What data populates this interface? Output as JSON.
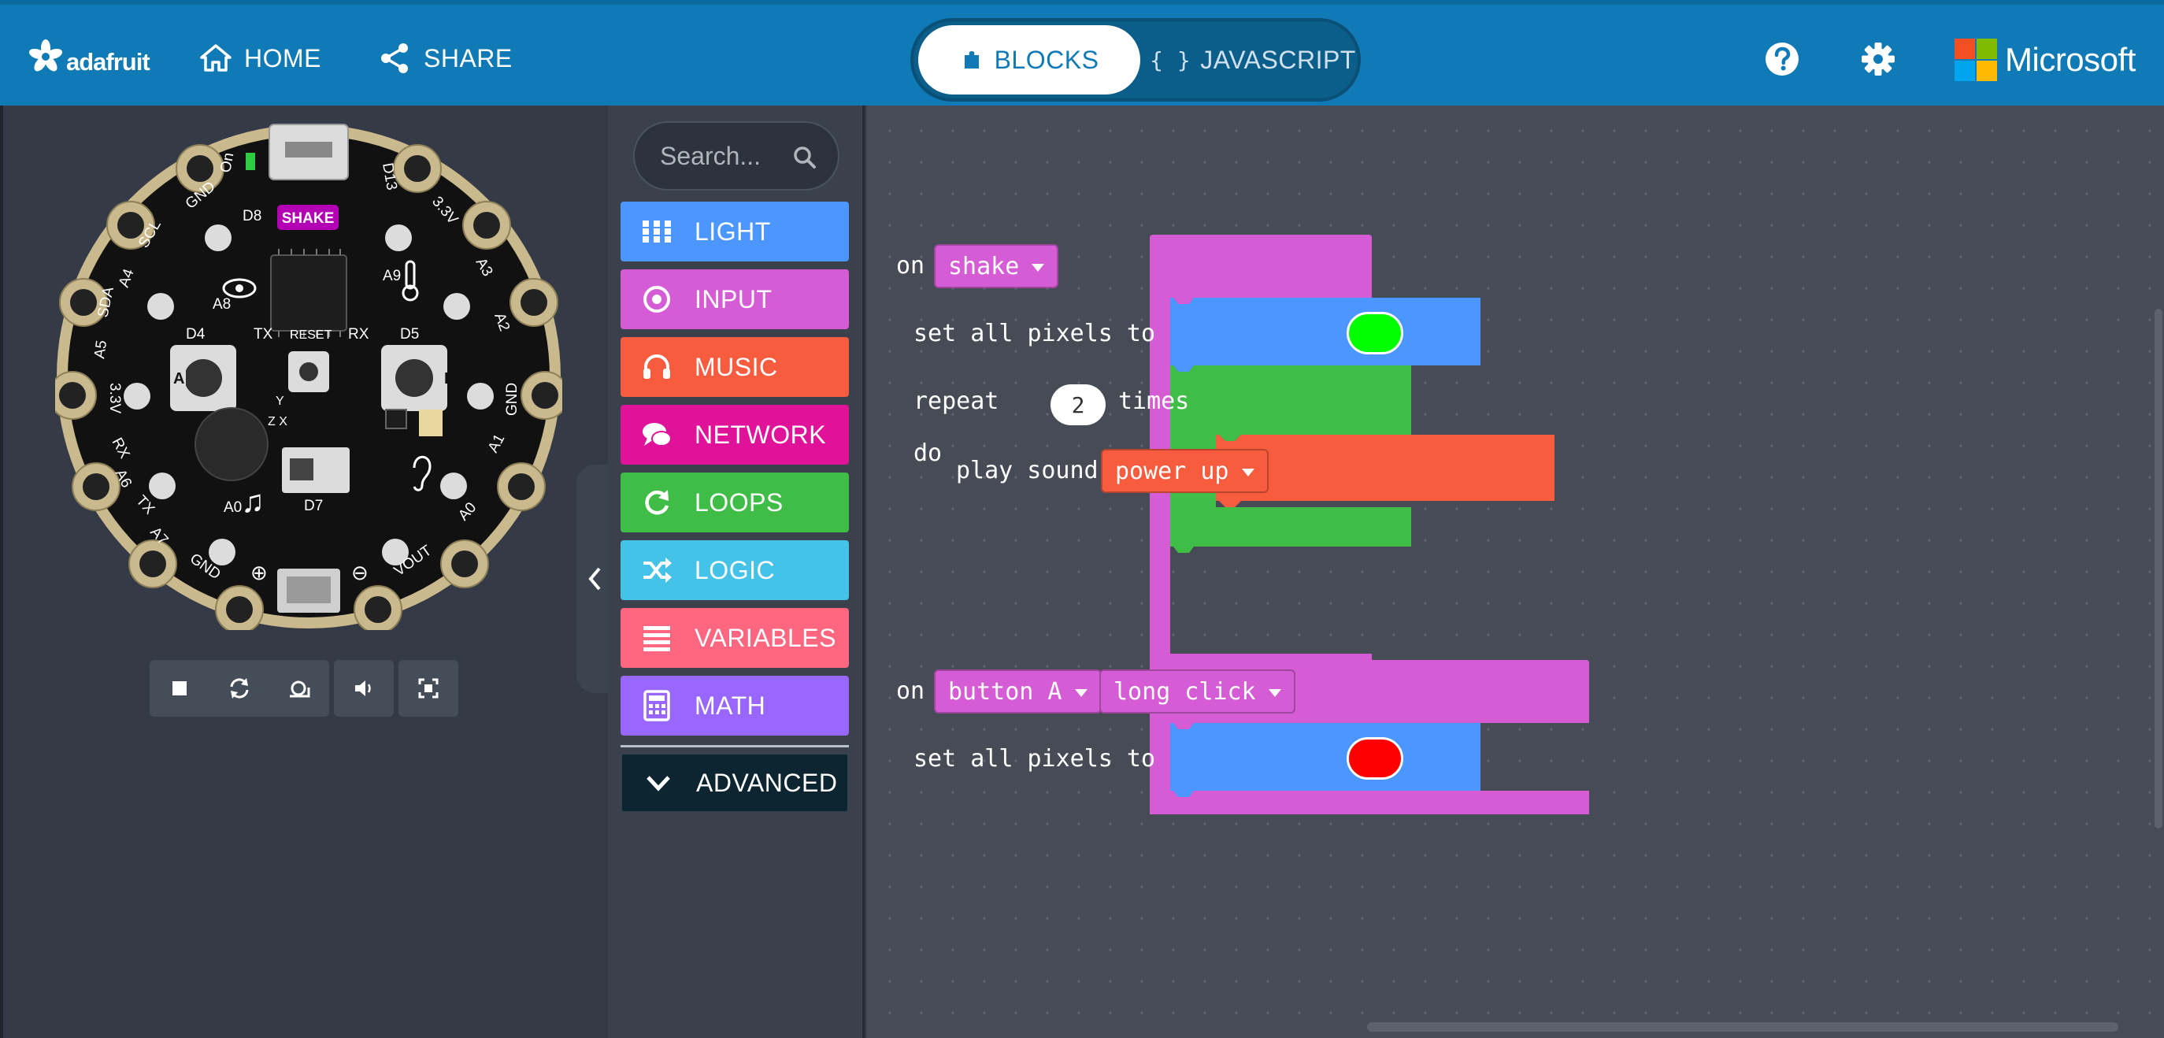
{
  "header": {
    "brand": "adafruit",
    "nav": {
      "home": "HOME",
      "share": "SHARE"
    },
    "mode_toggle": {
      "blocks": "BLOCKS",
      "javascript": "JAVASCRIPT",
      "active": "blocks"
    },
    "microsoft": "Microsoft"
  },
  "simulator": {
    "board_labels": {
      "shake": "SHAKE",
      "on": "On",
      "d13": "D13",
      "d8": "D8",
      "gnd_tl": "GND",
      "v33_tr": "3.3V",
      "scl": "SCL",
      "a3": "A3",
      "a4": "A4",
      "a2": "A2",
      "a8": "A8",
      "a9": "A9",
      "sda": "SDA",
      "a5": "A5",
      "d4": "D4",
      "tx_top": "TX",
      "reset": "RESET",
      "rx_top": "RX",
      "d5": "D5",
      "v33_l": "3.3V",
      "gnd_r": "GND",
      "btn_a": "A",
      "btn_b": "B",
      "rx": "RX",
      "a6": "A6",
      "a1": "A1",
      "tx": "TX",
      "a7": "A7",
      "a0_l": "A0",
      "a0_r": "A0",
      "d7": "D7",
      "gnd_b": "GND",
      "vout": "VOUT",
      "axis_y": "Y",
      "axis_zx": "Z  X"
    }
  },
  "toolbox": {
    "search_placeholder": "Search...",
    "categories": [
      {
        "label": "LIGHT",
        "color": "#4c97ff",
        "icon": "grid-icon"
      },
      {
        "label": "INPUT",
        "color": "#d65cd6",
        "icon": "target-icon"
      },
      {
        "label": "MUSIC",
        "color": "#f75c3f",
        "icon": "headphones-icon"
      },
      {
        "label": "NETWORK",
        "color": "#e0129a",
        "icon": "chat-icon"
      },
      {
        "label": "LOOPS",
        "color": "#3fbd47",
        "icon": "refresh-icon"
      },
      {
        "label": "LOGIC",
        "color": "#45c2e8",
        "icon": "shuffle-icon"
      },
      {
        "label": "VARIABLES",
        "color": "#ff6680",
        "icon": "list-icon"
      },
      {
        "label": "MATH",
        "color": "#9966ff",
        "icon": "calculator-icon"
      }
    ],
    "advanced": "ADVANCED"
  },
  "workspace": {
    "event1": {
      "keyword": "on",
      "dropdown": "shake",
      "set_pixels": "set all pixels to",
      "pixel_color": "#00ff00",
      "repeat": "repeat",
      "repeat_count": "2",
      "times": "times",
      "do": "do",
      "play_sound": "play sound",
      "sound": "power up"
    },
    "event2": {
      "keyword": "on",
      "button": "button A",
      "gesture": "long click",
      "set_pixels": "set all pixels to",
      "pixel_color": "#ff0000"
    }
  },
  "colors": {
    "header": "#0f7ab5",
    "event_block": "#d65cd6",
    "light_block": "#4c97ff",
    "loop_block": "#3fbd47",
    "music_block": "#f75c3f"
  }
}
